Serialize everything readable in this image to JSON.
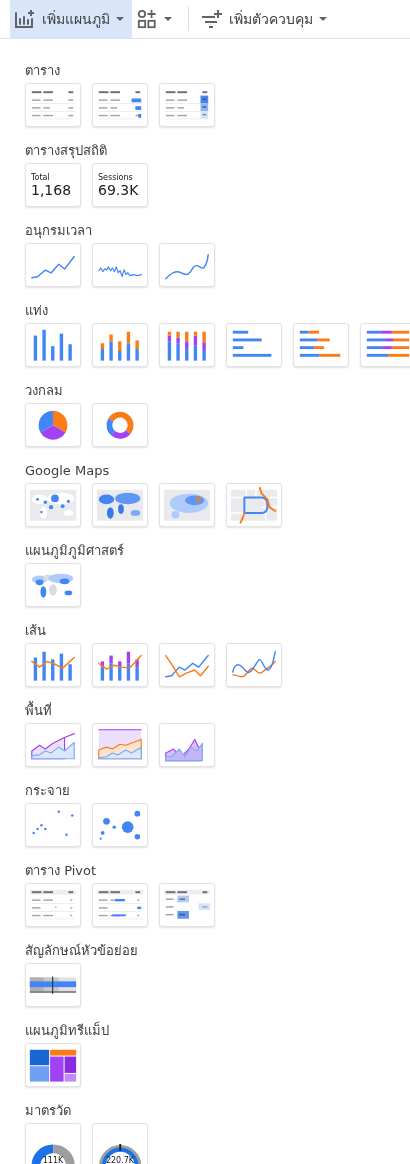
{
  "toolbar": [
    {
      "kind": "chart",
      "label": "เพิ่มแผนภูมิ",
      "selected": true
    },
    {
      "kind": "shapes",
      "selected": false
    },
    {
      "kind": "control",
      "label": "เพิ่มตัวควบคุม",
      "selected": false
    }
  ],
  "sections": [
    {
      "title": "ตาราง",
      "charts": [
        {
          "kind": "table"
        },
        {
          "kind": "table-bars"
        },
        {
          "kind": "table-heatmap"
        }
      ]
    },
    {
      "title": "ตารางสรุปสถิติ",
      "charts": [
        {
          "kind": "scorecard",
          "label": "Total",
          "value": "1,168"
        },
        {
          "kind": "scorecard",
          "label": "Sessions",
          "value": "69.3K"
        }
      ]
    },
    {
      "title": "อนุกรมเวลา",
      "charts": [
        {
          "kind": "timeseries"
        },
        {
          "kind": "sparkline"
        },
        {
          "kind": "smooth"
        }
      ]
    },
    {
      "title": "แท่ง",
      "charts": [
        {
          "kind": "column"
        },
        {
          "kind": "stacked-column"
        },
        {
          "kind": "stacked100-column"
        },
        {
          "kind": "bar"
        },
        {
          "kind": "stacked-bar"
        },
        {
          "kind": "stacked100-bar"
        }
      ]
    },
    {
      "title": "วงกลม",
      "charts": [
        {
          "kind": "pie"
        },
        {
          "kind": "donut"
        }
      ]
    },
    {
      "title": "Google Maps",
      "charts": [
        {
          "kind": "bubble-map"
        },
        {
          "kind": "filled-map"
        },
        {
          "kind": "heatmap-map"
        },
        {
          "kind": "route-map"
        }
      ]
    },
    {
      "title": "แผนภูมิภูมิศาสตร์",
      "charts": [
        {
          "kind": "geo-map"
        }
      ]
    },
    {
      "title": "เส้น",
      "charts": [
        {
          "kind": "combo"
        },
        {
          "kind": "stacked-combo"
        },
        {
          "kind": "line"
        },
        {
          "kind": "smooth-line"
        }
      ]
    },
    {
      "title": "พื้นที่",
      "charts": [
        {
          "kind": "area"
        },
        {
          "kind": "stacked-area"
        },
        {
          "kind": "overlap-area"
        }
      ]
    },
    {
      "title": "กระจาย",
      "charts": [
        {
          "kind": "scatter"
        },
        {
          "kind": "bubble"
        }
      ]
    },
    {
      "title": "ตาราง Pivot",
      "charts": [
        {
          "kind": "pivot"
        },
        {
          "kind": "pivot-bars"
        },
        {
          "kind": "pivot-heatmap"
        }
      ]
    },
    {
      "title": "สัญลักษณ์หัวข้อย่อย",
      "charts": [
        {
          "kind": "bullet"
        }
      ]
    },
    {
      "title": "แผนภูมิทรีแม็ป",
      "charts": [
        {
          "kind": "treemap"
        }
      ]
    },
    {
      "title": "มาตรวัด",
      "charts": [
        {
          "kind": "gauge",
          "value": "111K"
        },
        {
          "kind": "gauge-target",
          "value": "220.7K"
        }
      ]
    }
  ]
}
